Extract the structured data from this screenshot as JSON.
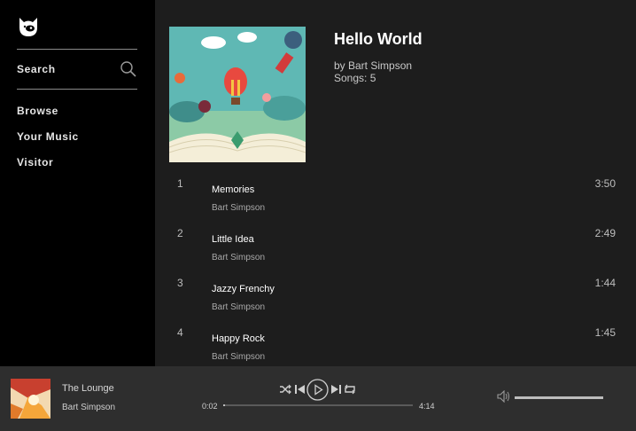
{
  "sidebar": {
    "search_label": "Search",
    "nav": [
      {
        "label": "Browse"
      },
      {
        "label": "Your Music"
      },
      {
        "label": "Visitor"
      }
    ]
  },
  "album": {
    "title": "Hello World",
    "artist": "by Bart Simpson",
    "songs": "Songs: 5"
  },
  "tracks": [
    {
      "num": "1",
      "title": "Memories",
      "artist": "Bart Simpson",
      "duration": "3:50"
    },
    {
      "num": "2",
      "title": "Little Idea",
      "artist": "Bart Simpson",
      "duration": "2:49"
    },
    {
      "num": "3",
      "title": "Jazzy Frenchy",
      "artist": "Bart Simpson",
      "duration": "1:44"
    },
    {
      "num": "4",
      "title": "Happy Rock",
      "artist": "Bart Simpson",
      "duration": "1:45"
    }
  ],
  "player": {
    "now_playing_title": "The Lounge",
    "now_playing_artist": "Bart Simpson",
    "current_time": "0:02",
    "total_time": "4:14",
    "progress_fraction": 0.008,
    "volume_fraction": 1.0,
    "controls": [
      "shuffle-icon",
      "previous-icon",
      "play-icon",
      "next-icon",
      "repeat-icon"
    ]
  },
  "colors": {
    "sidebar_bg": "#000000",
    "main_bg": "#1d1d1d",
    "player_bg": "#2e2e2e"
  }
}
